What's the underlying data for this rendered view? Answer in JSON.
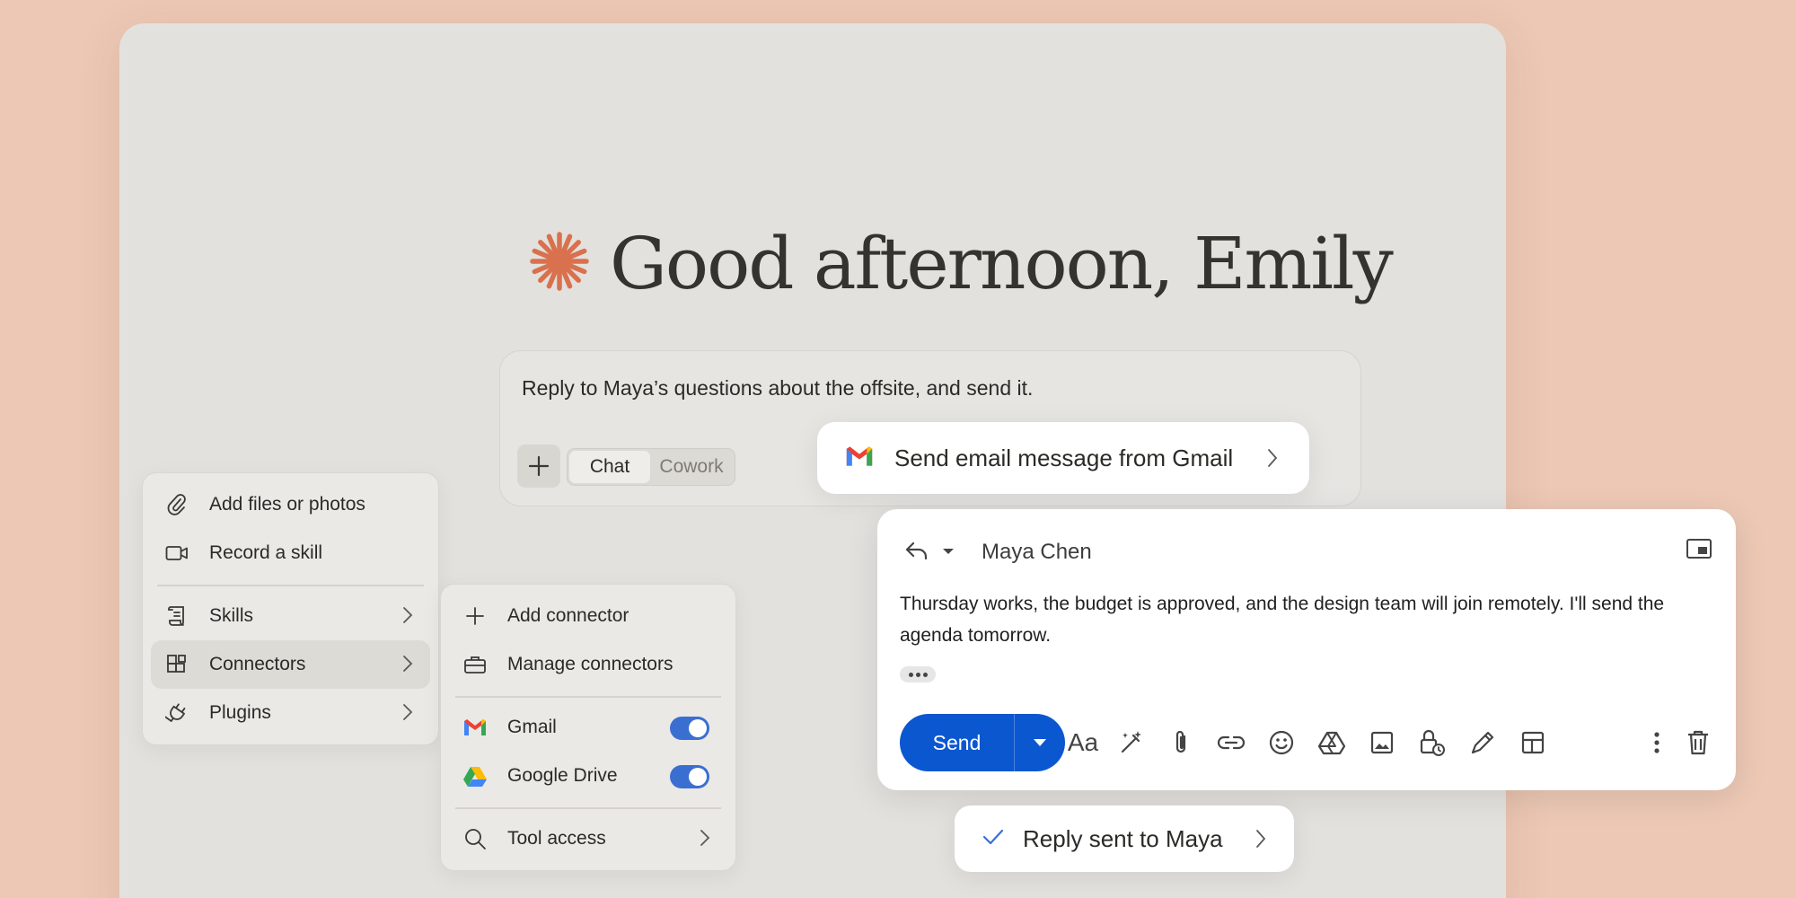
{
  "greeting": {
    "text": "Good afternoon, Emily"
  },
  "composer": {
    "prompt": "Reply to Maya’s questions about the offsite, and send it.",
    "modes": [
      "Chat",
      "Cowork"
    ],
    "active_mode": "Chat"
  },
  "menu_main": {
    "items": [
      {
        "label": "Add files or photos",
        "icon": "paperclip-icon"
      },
      {
        "label": "Record a skill",
        "icon": "video-camera-icon"
      },
      {
        "label": "Skills",
        "icon": "scroll-icon",
        "submenu": true
      },
      {
        "label": "Connectors",
        "icon": "connector-grid-icon",
        "submenu": true,
        "highlighted": true
      },
      {
        "label": "Plugins",
        "icon": "plug-icon",
        "submenu": true
      }
    ]
  },
  "menu_connectors": {
    "items": [
      {
        "label": "Add connector",
        "icon": "plus-icon"
      },
      {
        "label": "Manage connectors",
        "icon": "briefcase-icon"
      },
      {
        "label": "Gmail",
        "icon": "gmail-icon",
        "enabled": true
      },
      {
        "label": "Google Drive",
        "icon": "google-drive-icon",
        "enabled": true
      },
      {
        "label": "Tool access",
        "icon": "search-icon",
        "submenu": true
      }
    ]
  },
  "action_chip": {
    "label": "Send email message from Gmail",
    "icon": "gmail-icon"
  },
  "email": {
    "recipient": "Maya Chen",
    "body": "Thursday works, the budget is approved, and the design team will join remotely. I'll send the agenda tomorrow.",
    "send_label": "Send",
    "format_label": "Aa"
  },
  "status_chip": {
    "label": "Reply sent to Maya",
    "icon": "checkmark-icon"
  },
  "colors": {
    "background": "#ecc8b5",
    "window": "#e3e1dd",
    "accent": "#d9714e",
    "gmail_send": "#0b57d0",
    "toggle_on": "#3a6fd1"
  }
}
